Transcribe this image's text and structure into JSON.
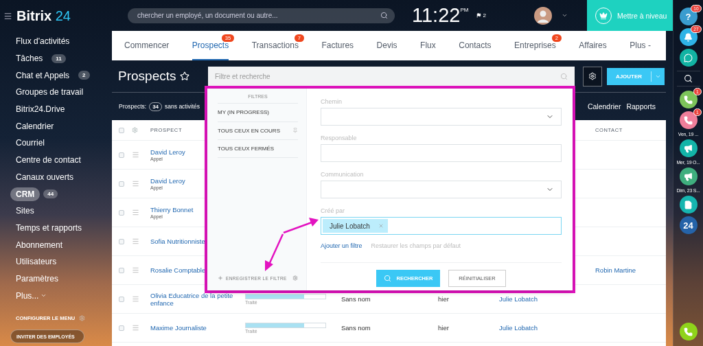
{
  "logo": {
    "name": "Bitrix",
    "suffix": "24"
  },
  "search": {
    "placeholder": "chercher un employé, un document ou autre..."
  },
  "clock": "11:22$^{PM}$",
  "flag_count": "2",
  "upgrade_button": "Mettre à niveau",
  "sidebar": {
    "items": [
      {
        "label": "Flux d'activités",
        "selected": false
      },
      {
        "label": "Tâches",
        "count": "11",
        "selected": false
      },
      {
        "label": "Chat et Appels",
        "count": "2",
        "selected": false
      },
      {
        "label": "Groupes de travail",
        "selected": false
      },
      {
        "label": "Bitrix24.Drive",
        "selected": false
      },
      {
        "label": "Calendrier",
        "selected": false
      },
      {
        "label": "Courriel",
        "selected": false
      },
      {
        "label": "Centre de contact",
        "selected": false
      },
      {
        "label": "Canaux ouverts",
        "selected": false
      },
      {
        "label": "CRM",
        "count": "44",
        "selected": true
      },
      {
        "label": "Sites",
        "selected": false
      },
      {
        "label": "Temps et rapports",
        "selected": false
      },
      {
        "label": "Abonnement",
        "selected": false
      },
      {
        "label": "Utilisateurs",
        "selected": false
      },
      {
        "label": "Paramètres",
        "selected": false
      }
    ],
    "more": "Plus...",
    "configure": "CONFIGURER LE MENU",
    "invite": "INVITER DES EMPLOYÉS"
  },
  "tabs": [
    {
      "label": "Commencer",
      "selected": false
    },
    {
      "label": "Prospects",
      "badge": "35",
      "selected": true
    },
    {
      "label": "Transactions",
      "badge": "7",
      "selected": false
    },
    {
      "label": "Factures",
      "selected": false
    },
    {
      "label": "Devis",
      "selected": false
    },
    {
      "label": "Flux",
      "selected": false
    },
    {
      "label": "Contacts",
      "selected": false
    },
    {
      "label": "Entreprises",
      "badge": "2",
      "selected": false
    },
    {
      "label": "Affaires",
      "selected": false
    },
    {
      "label": "Plus -",
      "selected": false
    }
  ],
  "page_title": "Prospects",
  "filter_field": {
    "placeholder": "Filtre et recherche"
  },
  "add_button": "AJOUTER",
  "summary": {
    "label": "Prospects:",
    "count": "34",
    "text": "sans activités"
  },
  "view_links": [
    "Calendrier",
    "Rapports"
  ],
  "table": {
    "columns": [
      "PROSPECT",
      "CONTACT"
    ],
    "all_checked": false,
    "rows": [
      {
        "prospect": "David Leroy",
        "subtitle": "Appel",
        "checked": false
      },
      {
        "prospect": "David Leroy",
        "subtitle": "Appel",
        "checked": false
      },
      {
        "prospect": "Thierry Bonnet",
        "subtitle": "Appel",
        "checked": false
      },
      {
        "prospect": "Sofia Nutritionniste",
        "checked": false
      },
      {
        "prospect": "Rosalie Comptable",
        "contact": "Robin Martine",
        "checked": false
      },
      {
        "prospect": "Olivia Educatrice de la petite enfance",
        "status": {
          "level": 0.73,
          "label": "Traité"
        },
        "column_3": "Sans nom",
        "column_4": "hier",
        "column_5": "Julie Lobatch",
        "checked": false
      },
      {
        "prospect": "Maxime Journaliste",
        "status": {
          "level": 0.73,
          "label": "Traité"
        },
        "column_3": "Sans nom",
        "column_4": "hier",
        "column_5": "Julie Lobatch",
        "checked": false
      }
    ]
  },
  "filter_popup": {
    "heading": "FILTRES",
    "presets": [
      {
        "label": "MY (IN PROGRESS)",
        "pinned": false,
        "selected": false
      },
      {
        "label": "TOUS CEUX EN COURS",
        "pinned": true,
        "selected": false
      },
      {
        "label": "TOUS CEUX FERMÉS",
        "pinned": false,
        "selected": false
      }
    ],
    "save": "ENREGISTRER LE FILTRE",
    "fields": [
      {
        "label": "Chemin",
        "kind": "select"
      },
      {
        "label": "Responsable",
        "kind": "text"
      },
      {
        "label": "Communication",
        "kind": "select"
      },
      {
        "label": "Créé par",
        "kind": "tags",
        "tags": [
          "Julie Lobatch"
        ]
      }
    ],
    "add_filter": "Ajouter un filtre",
    "restore": "Restaurer les champs par défaut",
    "search_button": "RECHERCHER",
    "reset_button": "RÉINITIALISER"
  },
  "right_rail": [
    {
      "kind": "help",
      "label": "?",
      "badge": "10",
      "color": "#3a9ccf"
    },
    {
      "kind": "bell",
      "badge": "27",
      "color": "#2fb3e6"
    },
    {
      "kind": "chat",
      "color": "#12b3a3"
    },
    {
      "kind": "search"
    },
    {
      "kind": "phone",
      "badge": "1",
      "color": "#7dc45a"
    },
    {
      "kind": "phone",
      "badge": "1",
      "color": "#ef7e9a",
      "caption": "Ven, 19 ..."
    },
    {
      "kind": "megaphone",
      "color": "#13b4a8",
      "caption": "Mer, 19 O..."
    },
    {
      "kind": "megaphone",
      "color": "#3fae7e",
      "caption": "Dim, 23 S..."
    },
    {
      "kind": "doc_search",
      "color": "#16b5b0"
    },
    {
      "kind": "label",
      "label": "24",
      "color": "#2563a8"
    }
  ],
  "call_button": {
    "color": "#8fd31b"
  }
}
